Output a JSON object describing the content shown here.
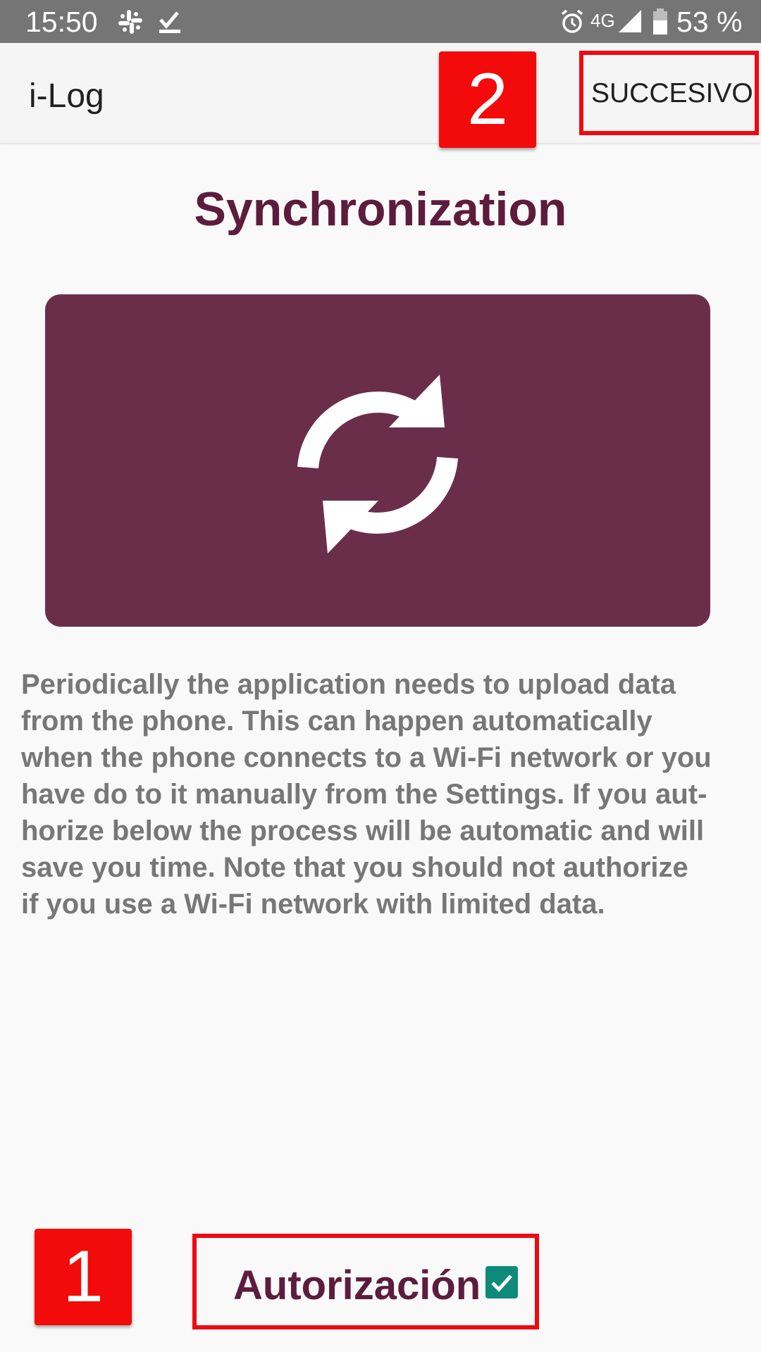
{
  "status_bar": {
    "time": "15:50",
    "icons_left": [
      "slack-icon",
      "download-done-icon"
    ],
    "icons_right": [
      "alarm-icon",
      "signal-icon",
      "battery-icon"
    ],
    "network": "4G",
    "battery_percent": "53 %"
  },
  "app_bar": {
    "title": "i-Log",
    "next_label": "SUCCESIVO"
  },
  "page": {
    "heading": "Synchronization",
    "illustration_icon": "sync-icon",
    "description": "Periodically the application needs to upload data\nfrom the phone. This can happen automatically\nwhen the phone connects to a Wi-Fi network or you\nhave do to it manually from the Settings. If you aut-\nhorize below the process will be automatic and will\nsave you time. Note that you should not authorize\nif you use a Wi-Fi network with limited data."
  },
  "authorization": {
    "label": "Autorización",
    "checked": true
  },
  "annotations": {
    "marker_1": "1",
    "marker_2": "2"
  },
  "colors": {
    "status_bar": "#757575",
    "accent_primary": "#5d1c3c",
    "panel": "#6a2e4b",
    "checkbox": "#0d8a79",
    "annotation_red": "#ee0a12"
  }
}
